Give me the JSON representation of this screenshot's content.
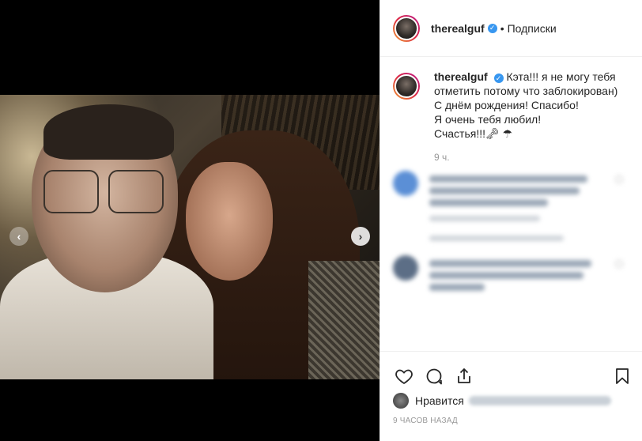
{
  "post": {
    "username": "therealguf",
    "follow_status": "Подписки",
    "separator": "•",
    "verified_mark": "✓"
  },
  "caption": {
    "username": "therealguf",
    "lines": [
      "Кэта!!! я не могу тебя",
      "отметить потому что заблокирован)",
      "С днём рождения! Спасибо!",
      "Я очень тебя любил!",
      "Счастья!!!🗝 ☂"
    ],
    "time": "9 ч."
  },
  "media": {
    "prev_arrow": "‹",
    "next_arrow": "›"
  },
  "comments": [
    {
      "avatar_color": "#5b8fd6"
    },
    {
      "avatar_color": "#5c6e86"
    }
  ],
  "likes": {
    "label": "Нравится"
  },
  "timestamp": "9 ЧАСОВ НАЗАД",
  "colors": {
    "verified": "#3897f0",
    "text": "#262626",
    "muted": "#999999"
  },
  "icons": [
    "heart-icon",
    "comment-icon",
    "share-icon",
    "bookmark-icon"
  ]
}
